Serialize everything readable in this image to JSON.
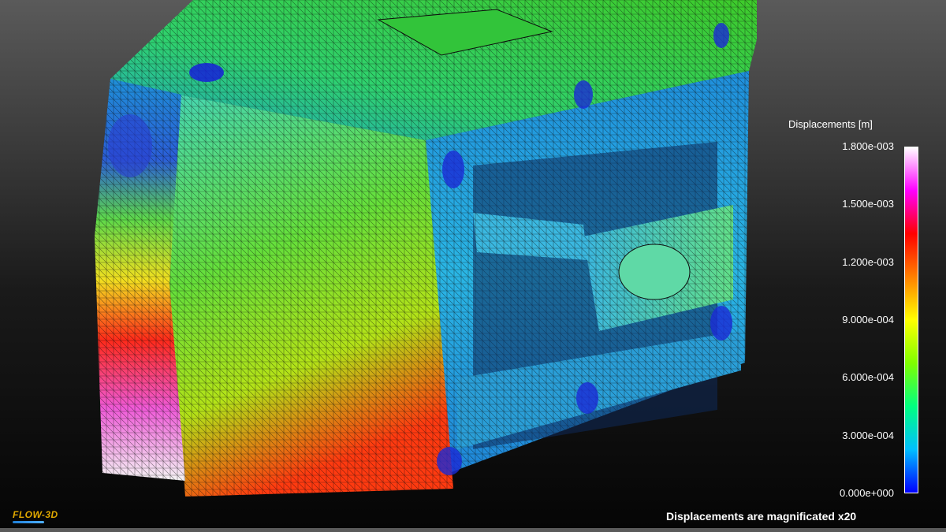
{
  "legend": {
    "title": "Displacements [m]",
    "ticks": [
      "1.800e-003",
      "1.500e-003",
      "1.200e-003",
      "9.000e-004",
      "6.000e-004",
      "3.000e-004",
      "0.000e+000"
    ],
    "min": 0,
    "max": 0.0018,
    "colormap": [
      "#0000ff",
      "#00bfff",
      "#00ff80",
      "#7fff00",
      "#ffff00",
      "#ff8000",
      "#ff0000",
      "#ff00ff",
      "#ffffff"
    ]
  },
  "footer_note": "Displacements are magnificated x20",
  "logo": "FLOW-3D",
  "colors": {
    "mesh_line": "#111111",
    "background_top": "#5a5a5a",
    "background_bottom": "#050505"
  }
}
